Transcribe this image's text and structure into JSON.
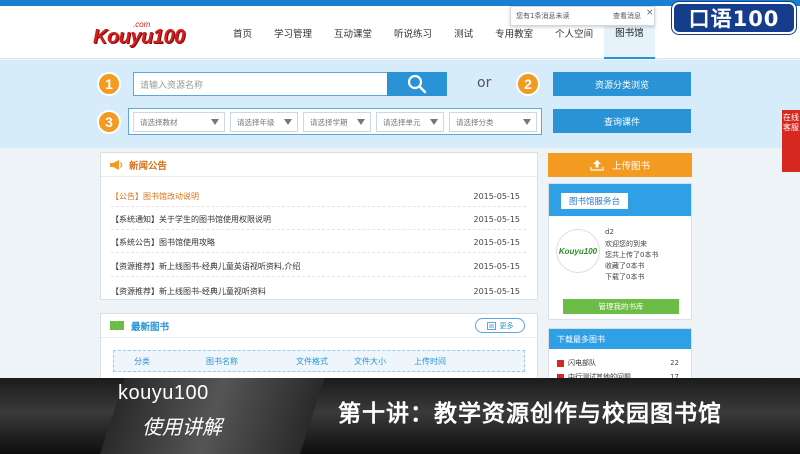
{
  "logo": {
    "brand": "Kouyu100",
    "com": ".com"
  },
  "nav": [
    "首页",
    "学习管理",
    "互动课堂",
    "听说练习",
    "测试",
    "专用教室",
    "个人空间",
    "图书馆"
  ],
  "notification": {
    "message": "您有1条消息未读",
    "view": "查看消息",
    "close": "×"
  },
  "badge": "口语100",
  "search": {
    "step1": "1",
    "step2": "2",
    "step3": "3",
    "placeholder": "请输入资源名称",
    "or": "or",
    "browse_label": "资源分类浏览",
    "query_label": "查询课件",
    "filters": [
      "请选择教材",
      "请选择年级",
      "请选择学期",
      "请选择单元",
      "请选择分类"
    ]
  },
  "side_tab": "在线客服",
  "news": {
    "title": "新闻公告",
    "items": [
      {
        "tag": "【公告】",
        "title": "图书馆改动说明",
        "date": "2015-05-15",
        "highlight": true
      },
      {
        "tag": "【系统通知】",
        "title": "关于学生的图书馆使用权限说明",
        "date": "2015-05-15",
        "highlight": false
      },
      {
        "tag": "【系统公告】",
        "title": "图书馆使用攻略",
        "date": "2015-05-15",
        "highlight": false
      },
      {
        "tag": "【资源推荐】",
        "title": "新上线图书-经典儿童英语视听资料,介绍",
        "date": "2015-05-15",
        "highlight": false
      },
      {
        "tag": "【资源推荐】",
        "title": "新上线图书-经典儿童视听资料",
        "date": "2015-05-15",
        "highlight": false
      }
    ]
  },
  "books": {
    "title": "最新图书",
    "more": "更多",
    "columns": [
      "分类",
      "图书名称",
      "文件格式",
      "文件大小",
      "上传时间"
    ]
  },
  "upload": {
    "label": "上传图书"
  },
  "service": {
    "title": "图书馆服务台",
    "avatar": "Kouyu100",
    "username": "d2",
    "welcome": "欢迎您的到来",
    "uploaded": "您共上传了0本书",
    "collected": "收藏了0本书",
    "downloaded": "下载了0本书",
    "manage": "管理我的书库"
  },
  "download_rank": {
    "title": "下载最多图书",
    "items": [
      {
        "name": "闪电部队",
        "count": "22"
      },
      {
        "name": "中行测试其他的问题",
        "count": "17"
      }
    ]
  },
  "banner": {
    "line1": "kouyu100",
    "line2": "使用讲解",
    "lecture": "第十讲：教学资源创作与校园图书馆"
  },
  "colors": {
    "accent": "#2a93d5",
    "orange": "#f39a21",
    "brand_red": "#d41d1d",
    "green": "#6cbd45"
  }
}
